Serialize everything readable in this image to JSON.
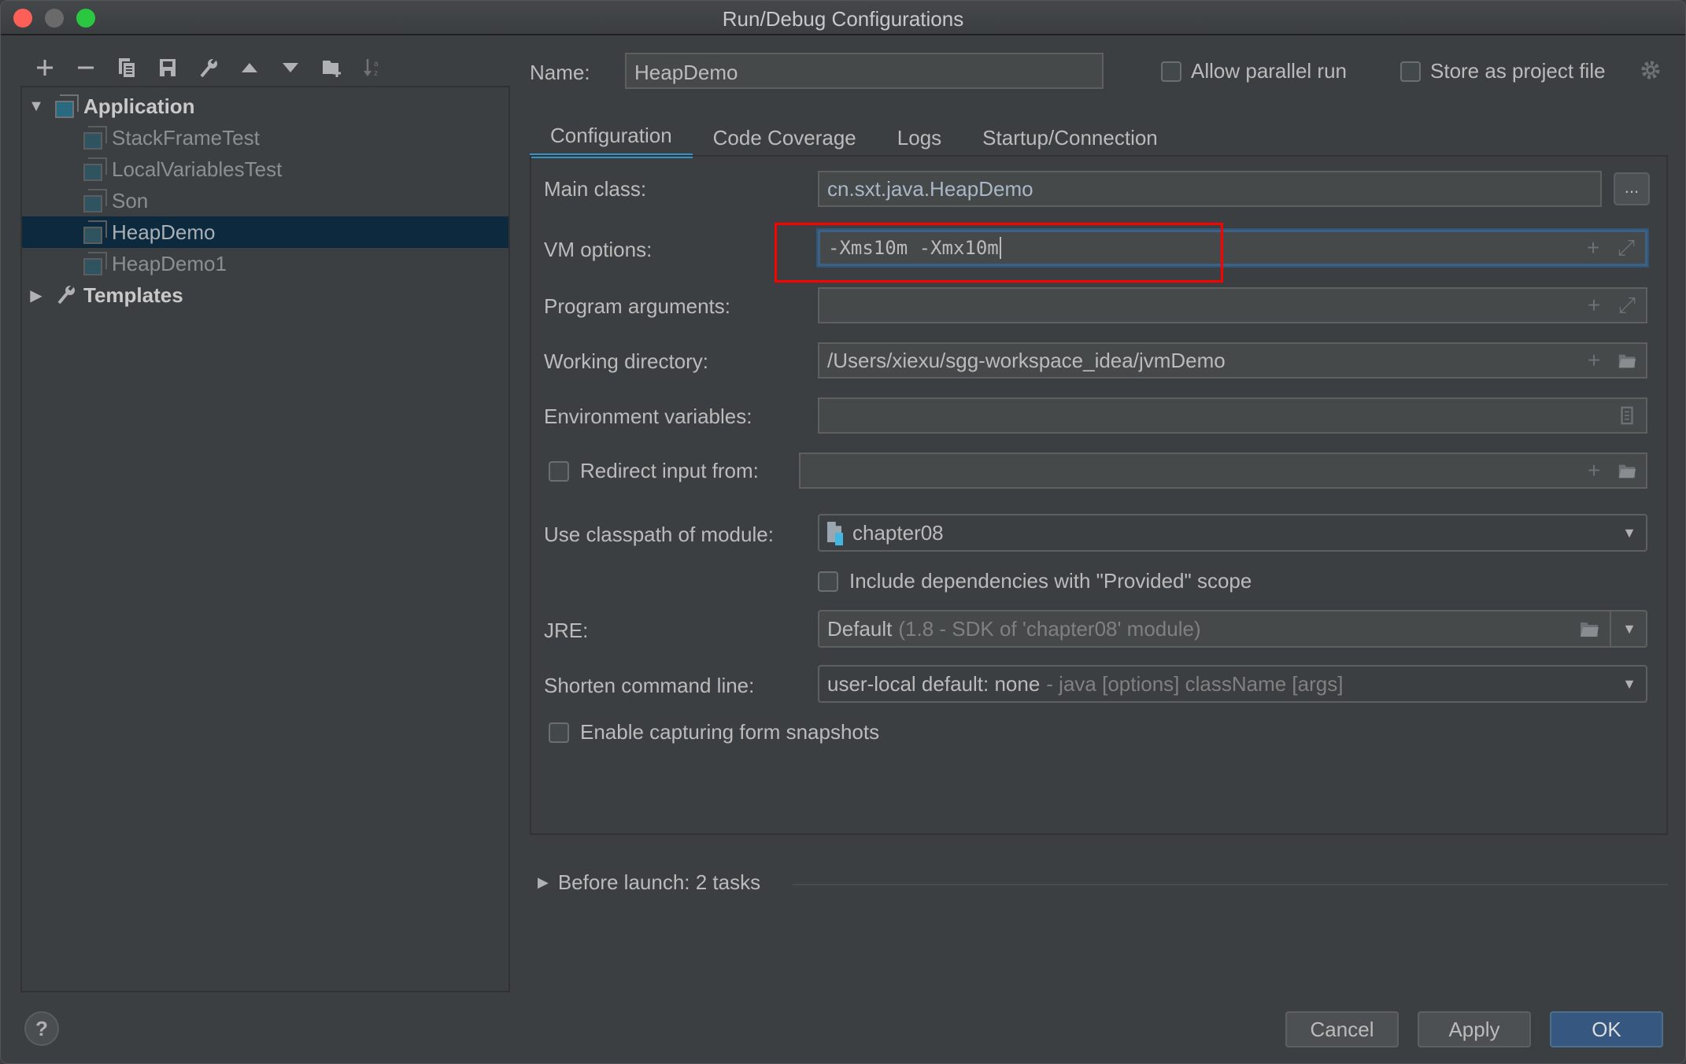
{
  "window": {
    "title": "Run/Debug Configurations"
  },
  "toolbar": {
    "buttons": [
      {
        "icon": "add-icon",
        "glyph": "+"
      },
      {
        "icon": "remove-icon",
        "glyph": "−"
      },
      {
        "icon": "copy-icon",
        "glyph": "copy"
      },
      {
        "icon": "save-icon",
        "glyph": "save"
      },
      {
        "icon": "wrench-icon",
        "glyph": "wrench"
      },
      {
        "icon": "move-up-icon",
        "glyph": "▲"
      },
      {
        "icon": "move-down-icon",
        "glyph": "▼"
      },
      {
        "icon": "new-folder-icon",
        "glyph": "folder"
      },
      {
        "icon": "sort-icon",
        "glyph": "sort"
      }
    ]
  },
  "tree": {
    "root": {
      "label": "Application",
      "expanded": true
    },
    "children": [
      {
        "label": "StackFrameTest",
        "selected": false
      },
      {
        "label": "LocalVariablesTest",
        "selected": false
      },
      {
        "label": "Son",
        "selected": false
      },
      {
        "label": "HeapDemo",
        "selected": true
      },
      {
        "label": "HeapDemo1",
        "selected": false
      }
    ],
    "templates": {
      "label": "Templates",
      "expanded": false
    }
  },
  "header": {
    "name_label": "Name:",
    "name_value": "HeapDemo",
    "allow_parallel_run": {
      "label": "Allow parallel run",
      "checked": false
    },
    "store_as_project_file": {
      "label": "Store as project file",
      "checked": false
    }
  },
  "tabs": [
    {
      "label": "Configuration",
      "active": true
    },
    {
      "label": "Code Coverage",
      "active": false
    },
    {
      "label": "Logs",
      "active": false
    },
    {
      "label": "Startup/Connection",
      "active": false
    }
  ],
  "form": {
    "main_class": {
      "label": "Main class:",
      "value": "cn.sxt.java.HeapDemo",
      "browse_label": "..."
    },
    "vm_options": {
      "label": "VM options:",
      "value": "-Xms10m -Xmx10m"
    },
    "program_arguments": {
      "label": "Program arguments:",
      "value": ""
    },
    "working_directory": {
      "label": "Working directory:",
      "value": "/Users/xiexu/sgg-workspace_idea/jvmDemo"
    },
    "environment_variables": {
      "label": "Environment variables:",
      "value": ""
    },
    "redirect_input": {
      "label": "Redirect input from:",
      "checked": false,
      "value": ""
    },
    "classpath_module": {
      "label": "Use classpath of module:",
      "value": "chapter08"
    },
    "include_provided": {
      "label": "Include dependencies with \"Provided\" scope",
      "checked": false
    },
    "jre": {
      "label": "JRE:",
      "value": "Default",
      "hint": "(1.8 - SDK of 'chapter08' module)"
    },
    "shorten_command_line": {
      "label": "Shorten command line:",
      "value": "user-local default: none",
      "hint": "- java [options] className [args]"
    },
    "enable_snapshots": {
      "label": "Enable capturing form snapshots",
      "checked": false
    }
  },
  "before_launch": {
    "label": "Before launch: 2 tasks",
    "expanded": false
  },
  "footer": {
    "help_label": "?",
    "cancel_label": "Cancel",
    "apply_label": "Apply",
    "ok_label": "OK"
  },
  "colors": {
    "accent": "#3592c4",
    "selection": "#0d293e",
    "primary_button": "#365880",
    "highlight_box": "#ff0000"
  }
}
